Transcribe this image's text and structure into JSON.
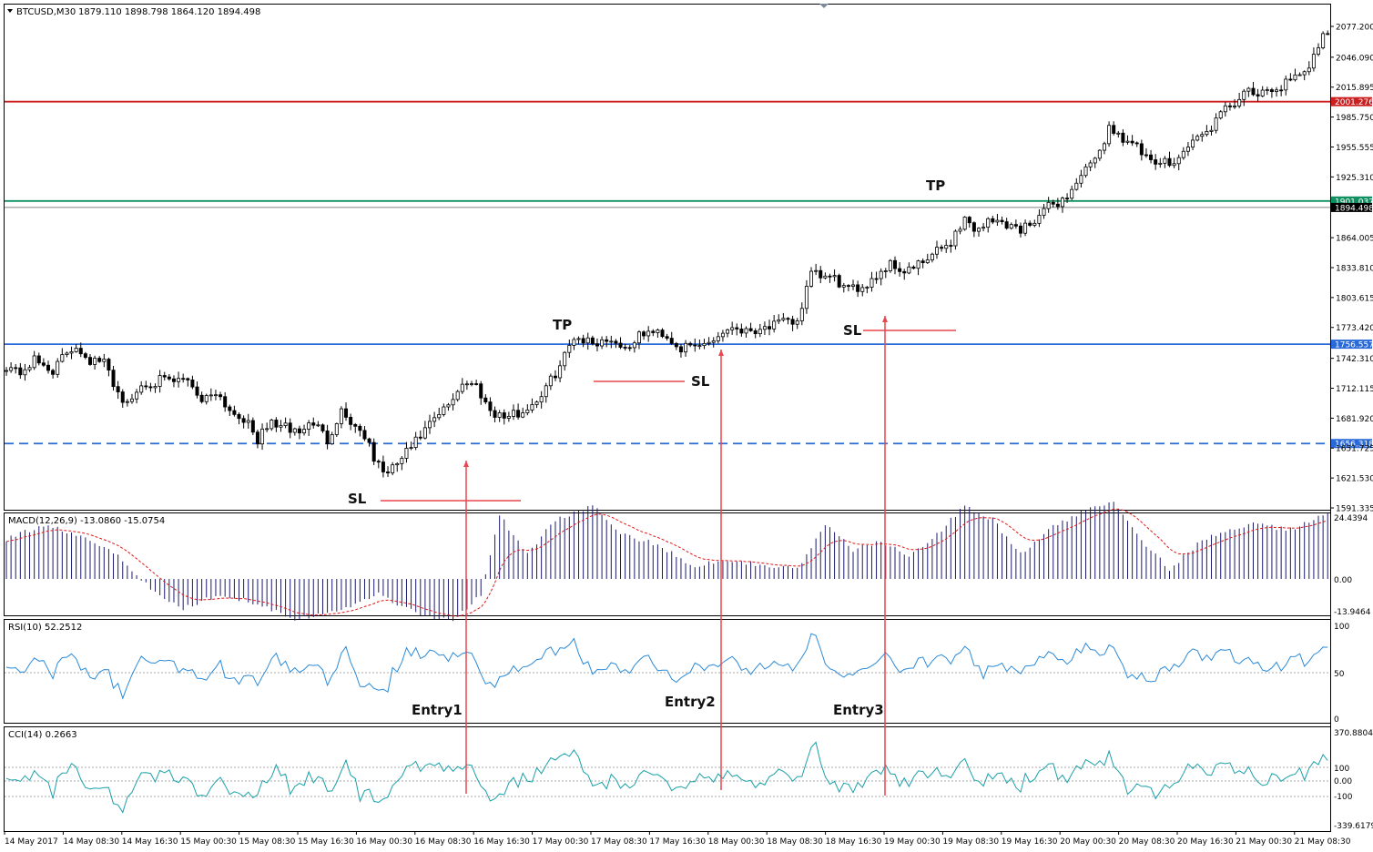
{
  "header": {
    "symbol": "BTCUSD,M30",
    "ohlc": "1879.110 1898.798 1864.120 1894.498"
  },
  "colors": {
    "bull": "#000000",
    "bear": "#000000",
    "red_level": "#cc1f1f",
    "green_level": "#109060",
    "blue_level": "#2a6ad8",
    "annotation_red": "#e8474f",
    "macd_hist": "#1a1a6e",
    "macd_signal": "#e01818",
    "rsi": "#2a8ad8",
    "cci": "#1aa0a8"
  },
  "chart_data": [
    {
      "type": "candlestick",
      "title": "BTCUSD,M30",
      "subtitle": "1879.110 1898.798 1864.120 1894.498",
      "ylim": [
        1591.335,
        2086
      ],
      "y_ticks": [
        "2077.200",
        "2046.090",
        "2015.895",
        "1985.750",
        "1955.555",
        "1925.310",
        "1894.498",
        "1864.005",
        "1833.810",
        "1803.615",
        "1773.420",
        "1742.310",
        "1712.115",
        "1681.920",
        "1651.725",
        "1621.530",
        "1591.335"
      ],
      "x_labels": [
        "14 May 2017",
        "14 May 08:30",
        "14 May 16:30",
        "15 May 00:30",
        "15 May 08:30",
        "15 May 16:30",
        "16 May 00:30",
        "16 May 08:30",
        "16 May 16:30",
        "17 May 00:30",
        "17 May 08:30",
        "17 May 16:30",
        "18 May 00:30",
        "18 May 08:30",
        "18 May 16:30",
        "19 May 00:30",
        "19 May 08:30",
        "19 May 16:30",
        "20 May 00:30",
        "20 May 08:30",
        "20 May 16:30",
        "21 May 00:30",
        "21 May 08:30"
      ],
      "levels": [
        {
          "label": "2001.276",
          "value": 2001.276,
          "color": "#cc1f1f",
          "style": "solid"
        },
        {
          "label": "1901.037",
          "value": 1901.037,
          "color": "#109060",
          "style": "solid"
        },
        {
          "label": "1894.498",
          "value": 1894.498,
          "color": "#808080",
          "style": "solid"
        },
        {
          "label": "1756.557",
          "value": 1756.557,
          "color": "#2a6ad8",
          "style": "solid"
        },
        {
          "label": "1656.318",
          "value": 1656.318,
          "color": "#2a6ad8",
          "style": "dashed"
        }
      ],
      "path_anchors": [
        [
          0,
          1735
        ],
        [
          3,
          1728
        ],
        [
          6,
          1740
        ],
        [
          10,
          1730
        ],
        [
          13,
          1748
        ],
        [
          15,
          1755
        ],
        [
          18,
          1740
        ],
        [
          21,
          1738
        ],
        [
          24,
          1708
        ],
        [
          26,
          1695
        ],
        [
          29,
          1715
        ],
        [
          33,
          1720
        ],
        [
          36,
          1718
        ],
        [
          39,
          1722
        ],
        [
          42,
          1700
        ],
        [
          45,
          1710
        ],
        [
          48,
          1690
        ],
        [
          51,
          1682
        ],
        [
          54,
          1660
        ],
        [
          57,
          1678
        ],
        [
          60,
          1672
        ],
        [
          63,
          1668
        ],
        [
          66,
          1678
        ],
        [
          69,
          1660
        ],
        [
          72,
          1690
        ],
        [
          74,
          1678
        ],
        [
          77,
          1665
        ],
        [
          79,
          1640
        ],
        [
          82,
          1625
        ],
        [
          85,
          1642
        ],
        [
          88,
          1658
        ],
        [
          91,
          1675
        ],
        [
          95,
          1695
        ],
        [
          98,
          1718
        ],
        [
          101,
          1715
        ],
        [
          104,
          1690
        ],
        [
          107,
          1683
        ],
        [
          111,
          1688
        ],
        [
          115,
          1705
        ],
        [
          119,
          1735
        ],
        [
          122,
          1765
        ],
        [
          126,
          1758
        ],
        [
          130,
          1762
        ],
        [
          133,
          1752
        ],
        [
          137,
          1768
        ],
        [
          141,
          1768
        ],
        [
          145,
          1752
        ],
        [
          149,
          1755
        ],
        [
          152,
          1762
        ],
        [
          156,
          1775
        ],
        [
          159,
          1770
        ],
        [
          163,
          1774
        ],
        [
          167,
          1778
        ],
        [
          170,
          1780
        ],
        [
          173,
          1827
        ],
        [
          175,
          1825
        ],
        [
          178,
          1822
        ],
        [
          181,
          1810
        ],
        [
          184,
          1815
        ],
        [
          187,
          1826
        ],
        [
          190,
          1838
        ],
        [
          193,
          1830
        ],
        [
          197,
          1838
        ],
        [
          200,
          1850
        ],
        [
          203,
          1860
        ],
        [
          206,
          1884
        ],
        [
          208,
          1872
        ],
        [
          211,
          1880
        ],
        [
          214,
          1880
        ],
        [
          218,
          1872
        ],
        [
          221,
          1883
        ],
        [
          224,
          1895
        ],
        [
          228,
          1905
        ],
        [
          231,
          1928
        ],
        [
          234,
          1940
        ],
        [
          237,
          1975
        ],
        [
          240,
          1965
        ],
        [
          243,
          1955
        ],
        [
          246,
          1938
        ],
        [
          249,
          1940
        ],
        [
          252,
          1945
        ],
        [
          255,
          1962
        ],
        [
          258,
          1970
        ],
        [
          261,
          1988
        ],
        [
          264,
          2001
        ],
        [
          267,
          2010
        ],
        [
          270,
          2008
        ],
        [
          273,
          2015
        ],
        [
          276,
          2022
        ],
        [
          279,
          2028
        ],
        [
          282,
          2060
        ],
        [
          283,
          2072
        ]
      ],
      "annotations": [
        {
          "text": "TP",
          "price": 1901.037
        },
        {
          "text": "TP",
          "price": 1756.557
        },
        {
          "text": "SL",
          "price": 1619
        },
        {
          "text": "SL",
          "price": 1722
        },
        {
          "text": "SL",
          "price": 1770
        },
        {
          "text": "Entry1",
          "price": 1655
        },
        {
          "text": "Entry2",
          "price": 1752
        },
        {
          "text": "Entry3",
          "price": 1790
        }
      ]
    },
    {
      "type": "bar",
      "title": "MACD(12,26,9) -13.0860 -15.0754",
      "ylim": [
        -13.9464,
        24.4394
      ],
      "y_ticks": [
        "24.4394",
        "0.00",
        "-13.9464"
      ],
      "histogram_anchors": [
        [
          0,
          16
        ],
        [
          8,
          22
        ],
        [
          16,
          18
        ],
        [
          24,
          10
        ],
        [
          32,
          -6
        ],
        [
          38,
          -12
        ],
        [
          46,
          -6
        ],
        [
          54,
          -10
        ],
        [
          62,
          -16
        ],
        [
          70,
          -14
        ],
        [
          80,
          -6
        ],
        [
          88,
          -14
        ],
        [
          96,
          -17
        ],
        [
          102,
          -6
        ],
        [
          106,
          26
        ],
        [
          112,
          10
        ],
        [
          118,
          24
        ],
        [
          126,
          30
        ],
        [
          132,
          18
        ],
        [
          140,
          14
        ],
        [
          148,
          5
        ],
        [
          154,
          8
        ],
        [
          162,
          6
        ],
        [
          170,
          4
        ],
        [
          176,
          22
        ],
        [
          182,
          12
        ],
        [
          188,
          15
        ],
        [
          194,
          10
        ],
        [
          200,
          18
        ],
        [
          206,
          30
        ],
        [
          212,
          24
        ],
        [
          218,
          10
        ],
        [
          224,
          20
        ],
        [
          232,
          28
        ],
        [
          238,
          32
        ],
        [
          244,
          16
        ],
        [
          250,
          4
        ],
        [
          256,
          14
        ],
        [
          262,
          20
        ],
        [
          268,
          22
        ],
        [
          276,
          20
        ],
        [
          283,
          26
        ]
      ]
    },
    {
      "type": "line",
      "title": "RSI(10) 52.2512",
      "ylim": [
        0,
        100
      ],
      "y_ticks": [
        "100",
        "50",
        "0"
      ],
      "reference_lines": [
        50
      ]
    },
    {
      "type": "line",
      "title": "CCI(14) 0.2663",
      "ylim": [
        -339.6179,
        370.8804
      ],
      "y_ticks": [
        "370.8804",
        "100",
        "0.00",
        "-100",
        "-339.6179"
      ],
      "reference_lines": [
        100,
        0,
        -100
      ]
    }
  ]
}
